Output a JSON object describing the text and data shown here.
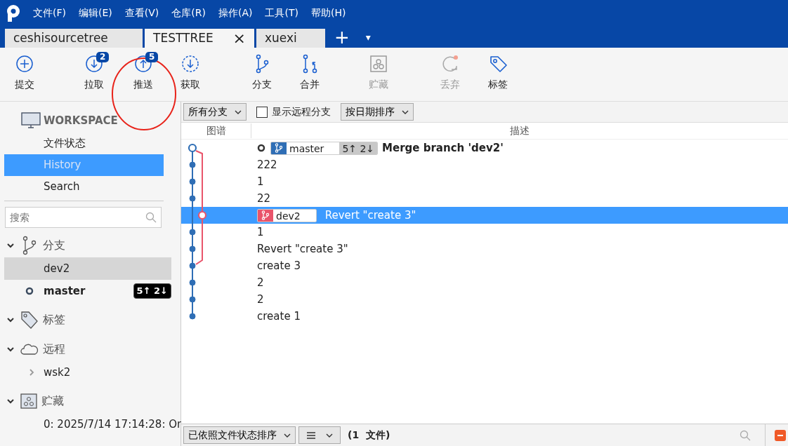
{
  "menu": [
    "文件(F)",
    "编辑(E)",
    "查看(V)",
    "仓库(R)",
    "操作(A)",
    "工具(T)",
    "帮助(H)"
  ],
  "tabs": [
    {
      "label": "ceshisourcetree",
      "selected": false
    },
    {
      "label": "TESTTREE",
      "selected": true,
      "close": "×"
    },
    {
      "label": "xuexi",
      "selected": false
    }
  ],
  "tab_actions": [
    "+",
    "▾"
  ],
  "toolbar": [
    {
      "kind": "commit",
      "label": "提交",
      "disabled": false
    },
    {
      "kind": "pull",
      "label": "拉取",
      "badge": "2",
      "disabled": false
    },
    {
      "kind": "push",
      "label": "推送",
      "badge": "5",
      "disabled": false,
      "highlighted": true
    },
    {
      "kind": "fetch",
      "label": "获取",
      "disabled": false
    },
    {
      "kind": "branch",
      "label": "分支",
      "disabled": false
    },
    {
      "kind": "merge",
      "label": "合并",
      "disabled": false
    },
    {
      "kind": "stash",
      "label": "贮藏",
      "disabled": true
    },
    {
      "kind": "discard",
      "label": "丢弃",
      "disabled": true
    },
    {
      "kind": "tag",
      "label": "标签",
      "disabled": false
    }
  ],
  "sidebar": {
    "workspace": {
      "title": "WORKSPACE",
      "items": [
        {
          "label": "文件状态",
          "selected": false
        },
        {
          "label": "History",
          "selected": true
        },
        {
          "label": "Search",
          "selected": false
        }
      ]
    },
    "search": {
      "placeholder": "搜索"
    },
    "sections": [
      {
        "kind": "branches",
        "title": "分支",
        "expanded": true,
        "items": [
          {
            "label": "dev2",
            "selected": true,
            "current": false
          },
          {
            "label": "master",
            "selected": false,
            "current": true,
            "badge": "5↑ 2↓"
          }
        ]
      },
      {
        "kind": "tags",
        "title": "标签",
        "expanded": true
      },
      {
        "kind": "remotes",
        "title": "远程",
        "expanded": true,
        "items": [
          {
            "label": "wsk2",
            "expanded": false
          }
        ]
      },
      {
        "kind": "stashes",
        "title": "贮藏",
        "expanded": true,
        "items": [
          {
            "label": "0: 2025/7/14 17:14:28: On"
          }
        ]
      }
    ]
  },
  "filters": {
    "branches": "所有分支",
    "show_remote": {
      "label": "显示远程分支",
      "checked": false
    },
    "sort": "按日期排序"
  },
  "history": {
    "columns": [
      "图谱",
      "描述"
    ],
    "commits": [
      {
        "kind": "merge",
        "head": true,
        "selected": false,
        "refs": [
          {
            "name": "master",
            "color": "#2f6eb5",
            "counts": "5↑ 2↓"
          }
        ],
        "message": "Merge branch 'dev2'"
      },
      {
        "kind": "main",
        "selected": false,
        "message": "222"
      },
      {
        "kind": "main",
        "selected": false,
        "message": "1"
      },
      {
        "kind": "main",
        "selected": false,
        "message": "22"
      },
      {
        "kind": "side",
        "selected": true,
        "refs": [
          {
            "name": "dev2",
            "color": "#e9546b"
          }
        ],
        "message": "Revert \"create 3\""
      },
      {
        "kind": "main",
        "selected": false,
        "message": "1"
      },
      {
        "kind": "main",
        "selected": false,
        "message": "Revert \"create 3\""
      },
      {
        "kind": "fork",
        "selected": false,
        "message": "create 3"
      },
      {
        "kind": "main",
        "selected": false,
        "message": "2"
      },
      {
        "kind": "main",
        "selected": false,
        "message": "2"
      },
      {
        "kind": "main",
        "selected": false,
        "message": "create 1"
      }
    ]
  },
  "bottom_bar": {
    "sort": "已依照文件状态排序",
    "count": "(1  文件)"
  }
}
